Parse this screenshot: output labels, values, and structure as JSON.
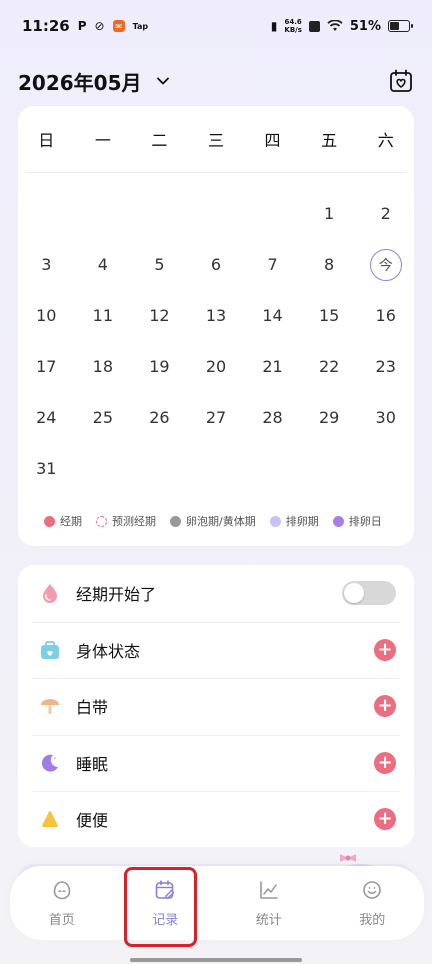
{
  "status_bar": {
    "time": "11:26",
    "app_icon_3": "Tap",
    "net_speed_value": "64.6",
    "net_speed_unit": "KB/s",
    "battery": "51%",
    "battery_level": 0.51
  },
  "header": {
    "month_title": "2026年05月"
  },
  "calendar": {
    "weekdays": [
      "日",
      "一",
      "二",
      "三",
      "四",
      "五",
      "六"
    ],
    "days": [
      "",
      "",
      "",
      "",
      "",
      "1",
      "2",
      "3",
      "4",
      "5",
      "6",
      "7",
      "8",
      "今",
      "10",
      "11",
      "12",
      "13",
      "14",
      "15",
      "16",
      "17",
      "18",
      "19",
      "20",
      "21",
      "22",
      "23",
      "24",
      "25",
      "26",
      "27",
      "28",
      "29",
      "30",
      "31"
    ],
    "today_marker": "今",
    "legend": [
      {
        "label": "经期",
        "color": "#ec6d80"
      },
      {
        "label": "预测经期",
        "color": "#ec6d80"
      },
      {
        "label": "卵泡期/黄体期",
        "color": "#999999"
      },
      {
        "label": "排卵期",
        "color": "#c8c2f4"
      },
      {
        "label": "排卵日",
        "color": "#a87ee8"
      }
    ]
  },
  "records": [
    {
      "label": "经期开始了",
      "icon": "peach-drop-icon",
      "control": "toggle",
      "toggle_on": false
    },
    {
      "label": "身体状态",
      "icon": "heart-bag-icon",
      "control": "add"
    },
    {
      "label": "白带",
      "icon": "mushroom-icon",
      "control": "add"
    },
    {
      "label": "睡眠",
      "icon": "moon-icon",
      "control": "add"
    },
    {
      "label": "便便",
      "icon": "poop-icon",
      "control": "add"
    }
  ],
  "add_symbol": "+",
  "nav": {
    "items": [
      {
        "label": "首页",
        "icon": "face-icon",
        "active": false
      },
      {
        "label": "记录",
        "icon": "calendar-edit-icon",
        "active": true
      },
      {
        "label": "统计",
        "icon": "chart-icon",
        "active": false
      },
      {
        "label": "我的",
        "icon": "smile-icon",
        "active": false
      }
    ]
  },
  "colors": {
    "accent": "#8a7fd6",
    "period": "#ec6d80",
    "highlight_box": "#d8222a"
  }
}
